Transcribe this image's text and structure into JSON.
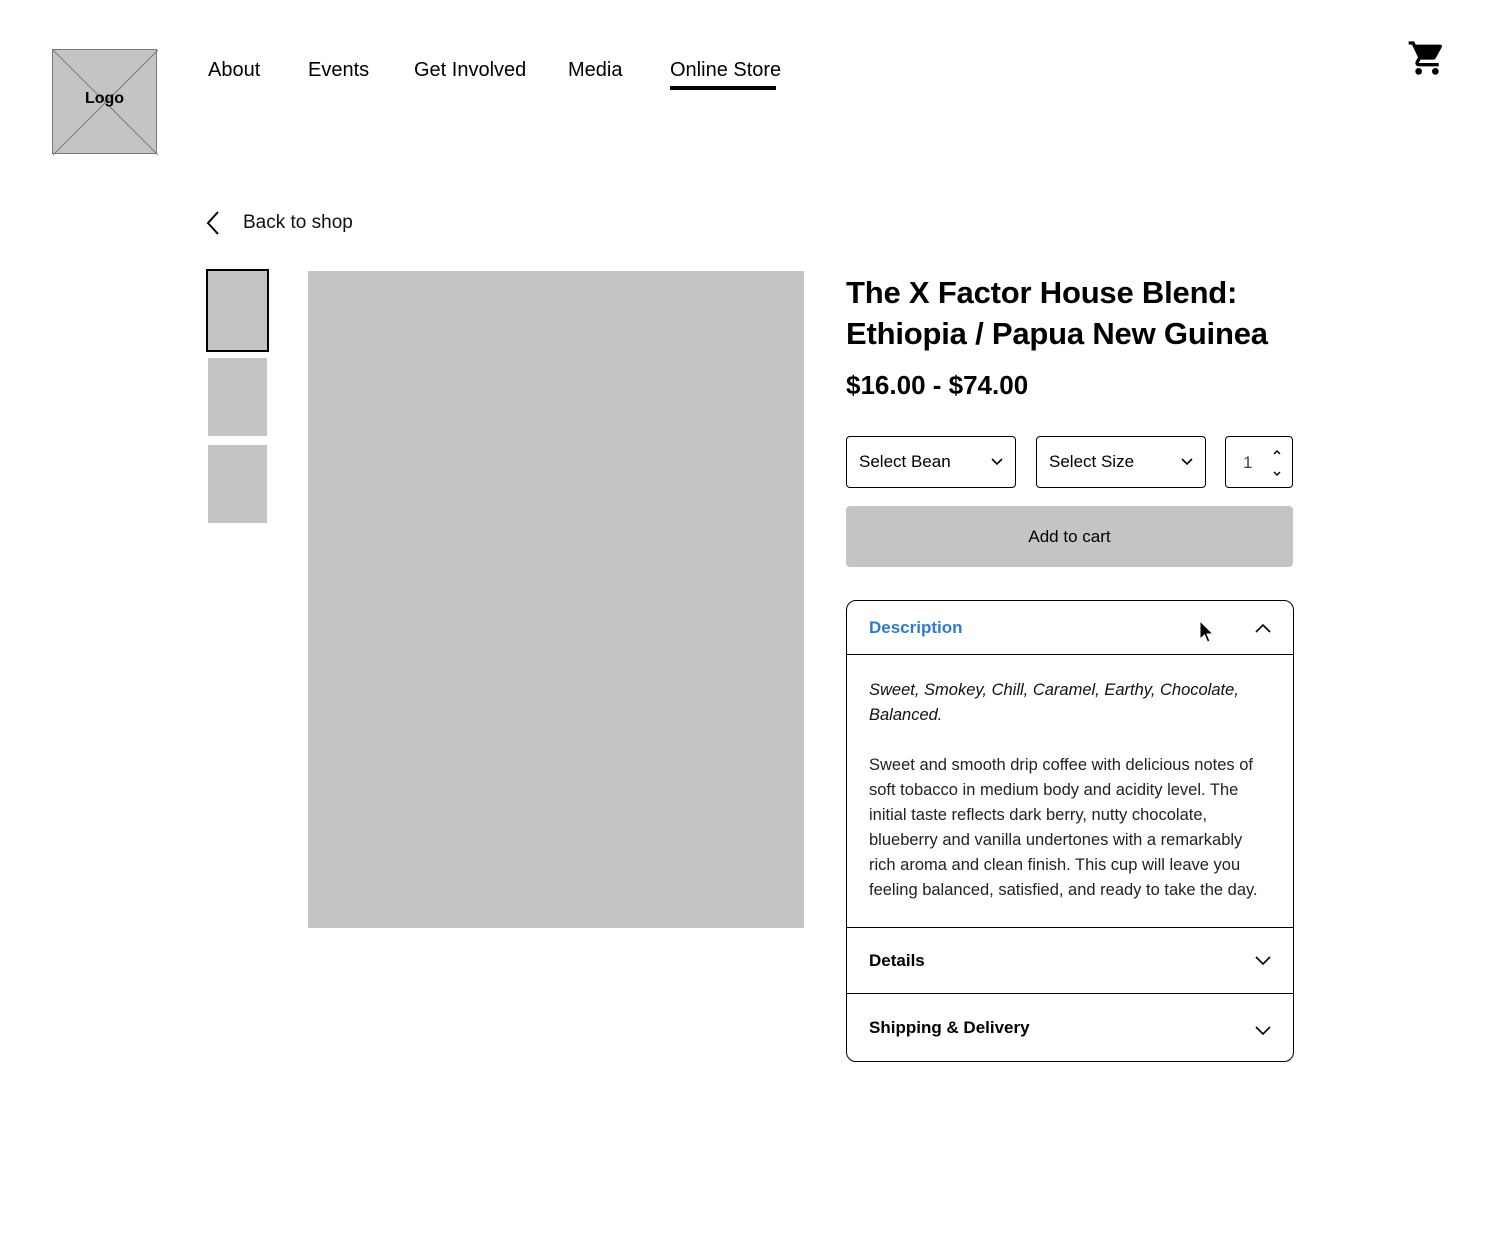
{
  "header": {
    "logo_label": "Logo",
    "nav": [
      {
        "label": "About",
        "active": false
      },
      {
        "label": "Events",
        "active": false
      },
      {
        "label": "Get Involved",
        "active": false
      },
      {
        "label": "Media",
        "active": false
      },
      {
        "label": "Online Store",
        "active": true
      }
    ],
    "cart_icon": "shopping-cart-icon"
  },
  "back": {
    "label": "Back to shop",
    "icon": "chevron-left-icon"
  },
  "gallery": {
    "thumbnail_count": 3,
    "selected_index": 0
  },
  "product": {
    "title": "The X Factor House Blend: Ethiopia / Papua New Guinea",
    "price": "$16.00 - $74.00",
    "bean_select": "Select Bean",
    "size_select": "Select Size",
    "quantity": "1",
    "add_to_cart": "Add to cart"
  },
  "accordion": {
    "description": {
      "label": "Description",
      "expanded": true,
      "tags": "Sweet, Smokey, Chill, Caramel, Earthy, Chocolate, Balanced.",
      "body": "Sweet and smooth drip coffee with delicious notes of soft tobacco in medium body and acidity level. The initial taste reflects dark berry, nutty chocolate, blueberry and vanilla undertones with a remarkably rich aroma and clean finish. This cup will leave you feeling balanced, satisfied, and ready to take the day."
    },
    "details": {
      "label": "Details",
      "expanded": false
    },
    "shipping": {
      "label": "Shipping & Delivery",
      "expanded": false
    }
  },
  "colors": {
    "accent": "#2e7bd6",
    "placeholder": "#c4c4c4"
  }
}
